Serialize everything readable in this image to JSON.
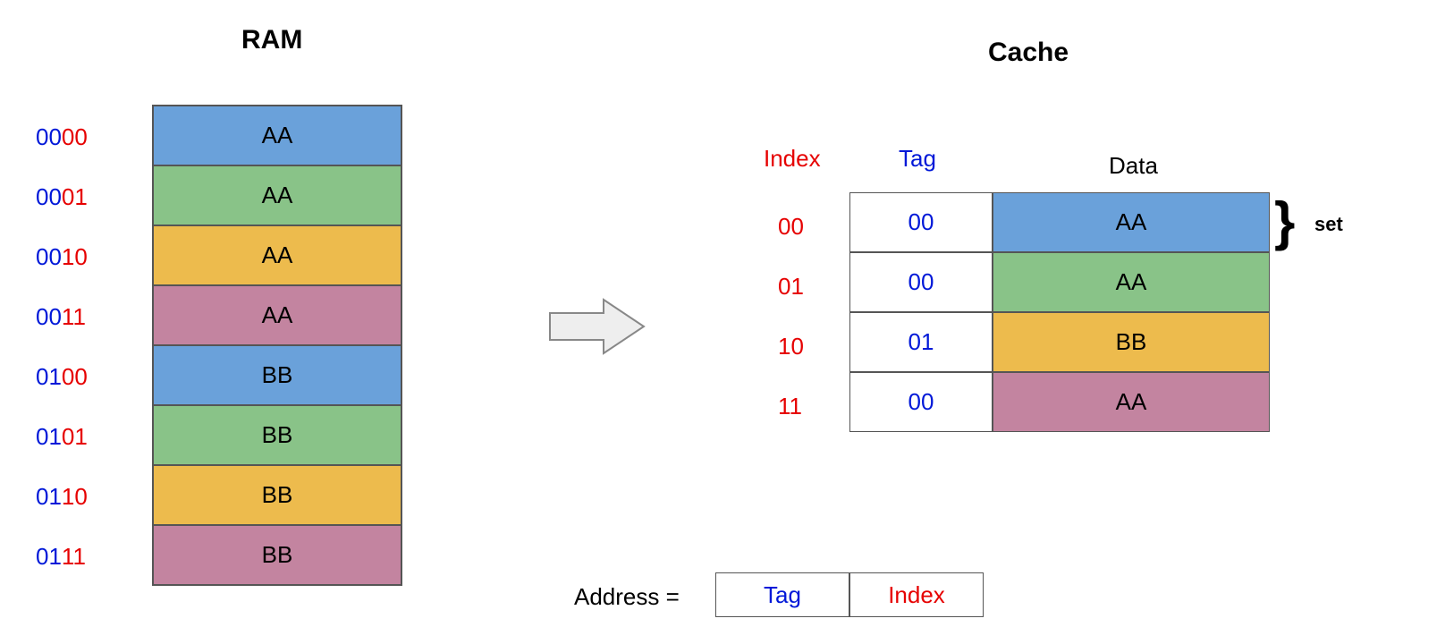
{
  "titles": {
    "ram": "RAM",
    "cache": "Cache"
  },
  "colors": {
    "blue": "#6aa1da",
    "green": "#89c388",
    "yellow": "#edbb4d",
    "rose": "#c384a0",
    "text_blue": "#0018d8",
    "text_red": "#e60000"
  },
  "ram": {
    "rows": [
      {
        "tag": "00",
        "index": "00",
        "data": "AA",
        "color": "c0"
      },
      {
        "tag": "00",
        "index": "01",
        "data": "AA",
        "color": "c1"
      },
      {
        "tag": "00",
        "index": "10",
        "data": "AA",
        "color": "c2"
      },
      {
        "tag": "00",
        "index": "11",
        "data": "AA",
        "color": "c3"
      },
      {
        "tag": "01",
        "index": "00",
        "data": "BB",
        "color": "c0"
      },
      {
        "tag": "01",
        "index": "01",
        "data": "BB",
        "color": "c1"
      },
      {
        "tag": "01",
        "index": "10",
        "data": "BB",
        "color": "c2"
      },
      {
        "tag": "01",
        "index": "11",
        "data": "BB",
        "color": "c3"
      }
    ]
  },
  "cache": {
    "headers": {
      "index": "Index",
      "tag": "Tag",
      "data": "Data"
    },
    "rows": [
      {
        "index": "00",
        "tag": "00",
        "data": "AA",
        "color": "c0"
      },
      {
        "index": "01",
        "tag": "00",
        "data": "AA",
        "color": "c1"
      },
      {
        "index": "10",
        "tag": "01",
        "data": "BB",
        "color": "c2"
      },
      {
        "index": "11",
        "tag": "00",
        "data": "AA",
        "color": "c3"
      }
    ],
    "set_label": "set",
    "brace": "}"
  },
  "address": {
    "label": "Address =",
    "parts": {
      "tag": "Tag",
      "index": "Index"
    }
  }
}
